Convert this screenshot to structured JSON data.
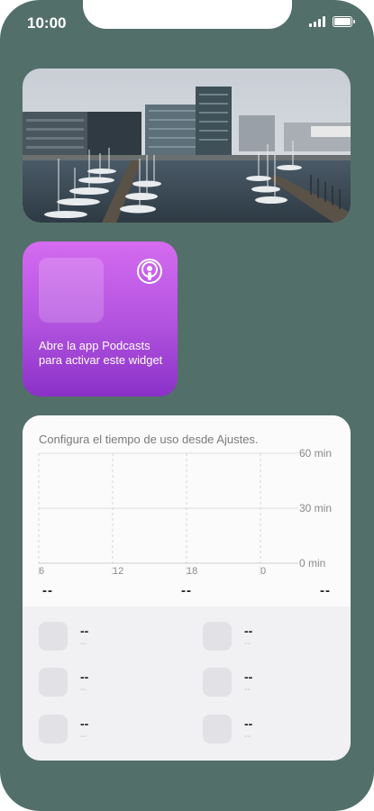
{
  "status_bar": {
    "time": "10:00"
  },
  "photo_widget": {
    "scene": "harbor-marina-photo"
  },
  "podcasts_widget": {
    "message": "Abre la app Podcasts para activar este widget",
    "colors": {
      "top": "#d56bf0",
      "bottom": "#8b31c8"
    },
    "icon": "podcasts-icon"
  },
  "screen_time_widget": {
    "message": "Configura el tiempo de uso desde Ajustes.",
    "chart_data": {
      "type": "bar",
      "categories": [
        "6",
        "12",
        "18",
        "0"
      ],
      "ytick_labels": [
        "60 min",
        "30 min",
        "0 min"
      ],
      "values": [],
      "ylim": [
        0,
        60
      ],
      "grid": true
    },
    "summary": [
      "--",
      "--",
      "--"
    ],
    "apps": [
      {
        "value": "--",
        "sub": "--"
      },
      {
        "value": "--",
        "sub": "--"
      },
      {
        "value": "--",
        "sub": "--"
      },
      {
        "value": "--",
        "sub": "--"
      },
      {
        "value": "--",
        "sub": "--"
      },
      {
        "value": "--",
        "sub": "--"
      }
    ]
  },
  "colors": {
    "wallpaper": "#536f69"
  }
}
